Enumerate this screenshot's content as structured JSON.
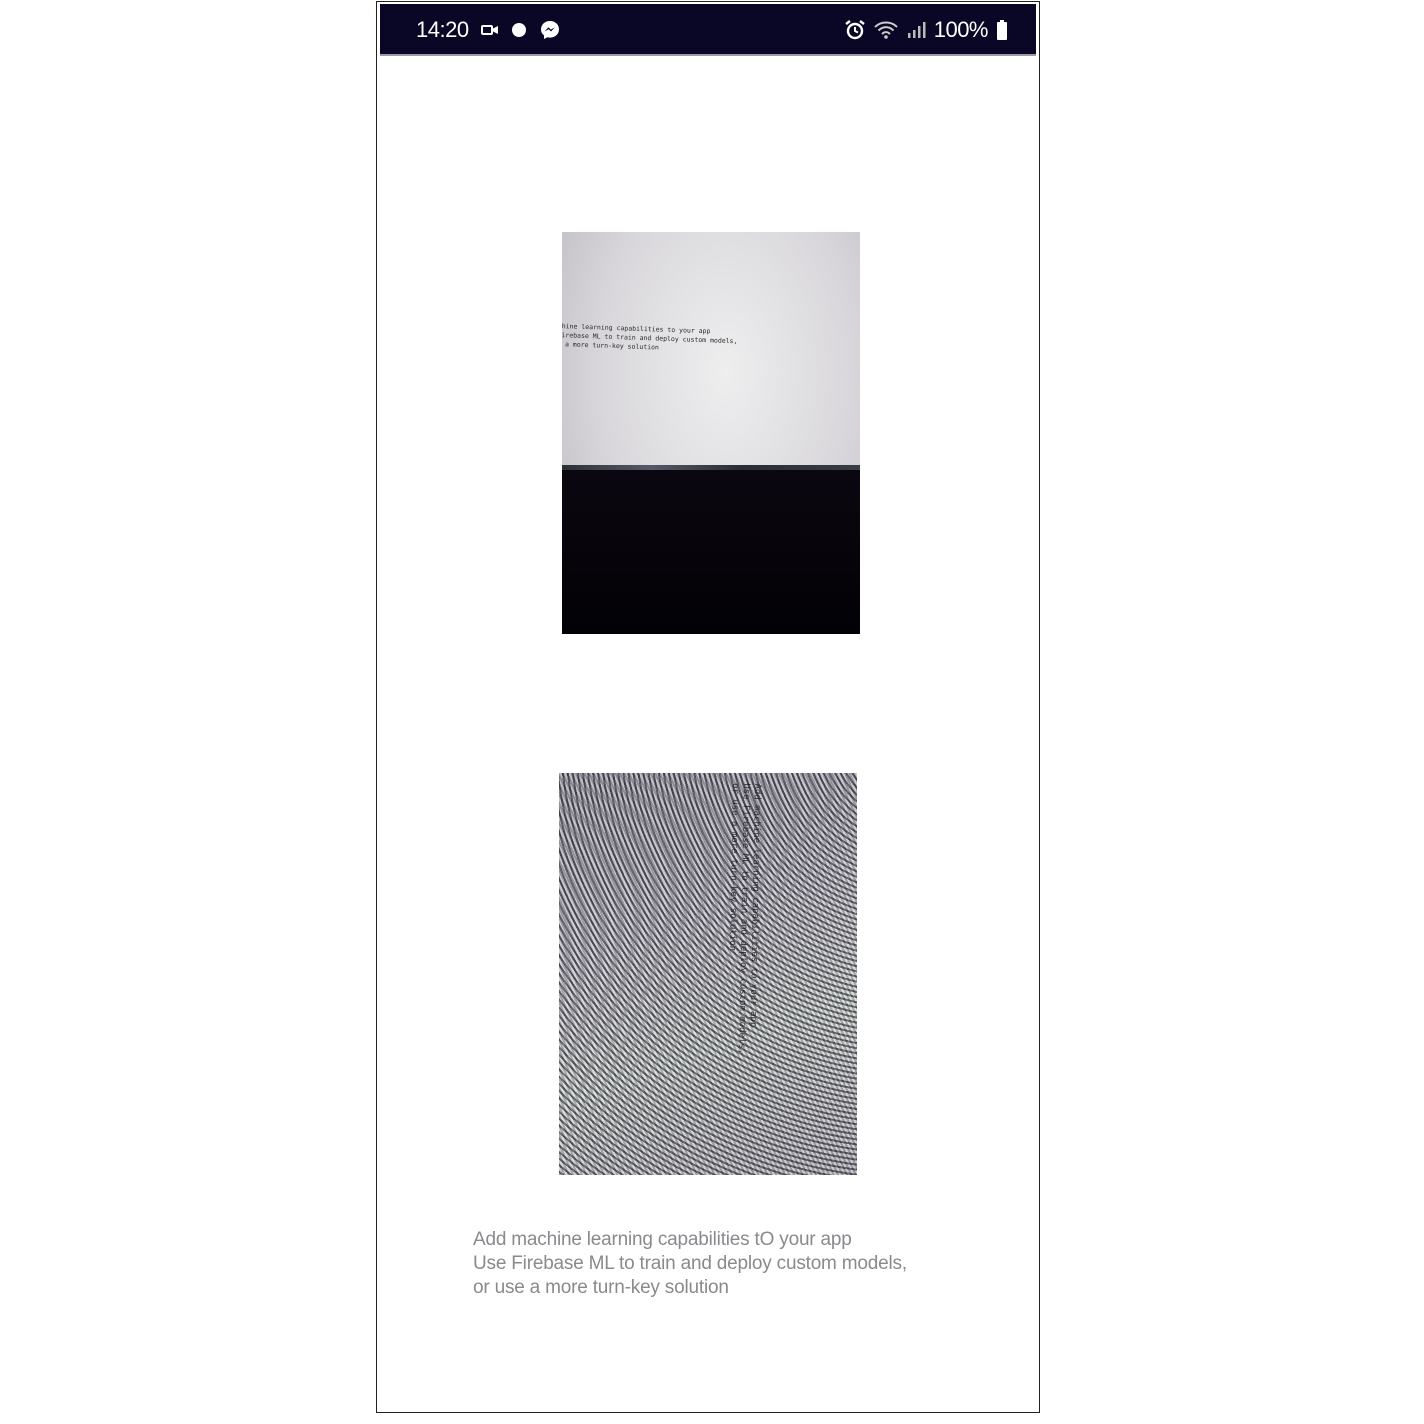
{
  "status_bar": {
    "time": "14:20",
    "left_icons": [
      "video-call-icon",
      "dot-notification-icon",
      "messenger-icon"
    ],
    "right_icons": [
      "alarm-icon",
      "wifi-icon",
      "signal-icon"
    ],
    "battery": "100%",
    "background": "#0a0726"
  },
  "images": [
    {
      "name": "photo-of-laptop-screen",
      "text_lines": [
        "chine learning capabilities to your app",
        "Firebase ML to train and deploy custom models,",
        "e a more turn-key solution"
      ]
    },
    {
      "name": "rotated-moire-photo",
      "text_lines": [
        "Add machine learning capabilities to your app",
        "Use Firebase ML to train and deploy custom models,",
        "or use a more turn-key solution"
      ]
    }
  ],
  "caption": {
    "lines": [
      "Add machine learning capabilities tO your app",
      "Use Firebase ML to train and deploy custom models,",
      "or use a more turn-key solution"
    ],
    "color": "#8a8a8e"
  }
}
